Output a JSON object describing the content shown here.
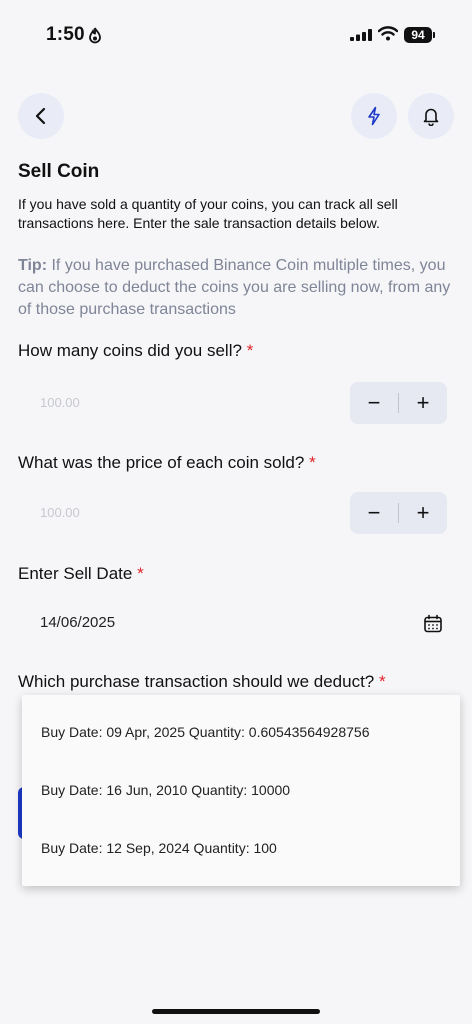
{
  "status": {
    "time": "1:50",
    "battery": "94"
  },
  "page": {
    "title": "Sell Coin",
    "description": "If you have sold a quantity of your coins, you can track all sell transactions here. Enter the sale transaction details below.",
    "tip_label": "Tip:",
    "tip_text": " If you have purchased Binance Coin multiple times, you can choose to deduct the coins you are selling now, from any of those purchase transactions"
  },
  "form": {
    "coins_label": "How many coins did you sell?",
    "coins_placeholder": "100.00",
    "price_label": "What was the price of each coin sold?",
    "price_placeholder": "100.00",
    "date_label": "Enter Sell Date",
    "date_value": "14/06/2025",
    "deduct_label": "Which purchase transaction should we deduct?",
    "required_mark": "*",
    "minus": "−",
    "plus": "+"
  },
  "dropdown": {
    "options": [
      "Buy Date: 09 Apr, 2025 Quantity: 0.60543564928756",
      "Buy Date: 16 Jun, 2010 Quantity: 10000",
      "Buy Date: 12 Sep, 2024 Quantity: 100"
    ]
  },
  "colors": {
    "accent": "#1c39c9",
    "required": "#e0242a",
    "button_bg": "#e9ecf6"
  },
  "icons": [
    "back-icon",
    "bolt-icon",
    "bell-icon",
    "calendar-icon"
  ]
}
